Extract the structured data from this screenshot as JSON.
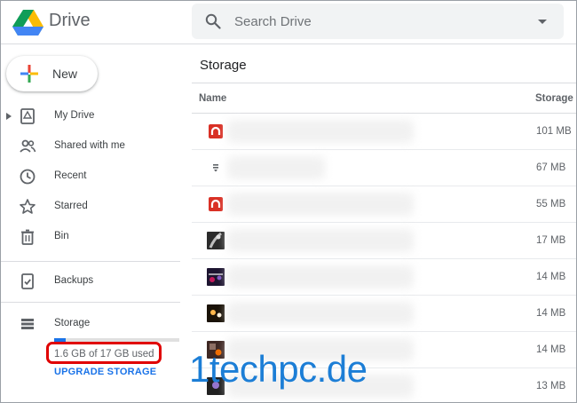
{
  "app": {
    "title": "Drive"
  },
  "search": {
    "placeholder": "Search Drive"
  },
  "sidebar": {
    "new_label": "New",
    "items": [
      {
        "label": "My Drive",
        "icon": "my-drive-icon"
      },
      {
        "label": "Shared with me",
        "icon": "shared-icon"
      },
      {
        "label": "Recent",
        "icon": "clock-icon"
      },
      {
        "label": "Starred",
        "icon": "star-icon"
      },
      {
        "label": "Bin",
        "icon": "trash-icon"
      },
      {
        "label": "Backups",
        "icon": "backup-icon"
      },
      {
        "label": "Storage",
        "icon": "storage-icon"
      }
    ],
    "quota": {
      "text": "1.6 GB of 17 GB used",
      "used_fraction": 0.094,
      "upgrade_label": "UPGRADE STORAGE"
    }
  },
  "main": {
    "title": "Storage",
    "columns": {
      "name": "Name",
      "size": "Storage used"
    },
    "rows": [
      {
        "thumb": "red-app-icon",
        "size": "101 MB"
      },
      {
        "thumb": "generic-file-icon",
        "size": "67 MB"
      },
      {
        "thumb": "red-app-icon",
        "size": "55 MB"
      },
      {
        "thumb": "photo-thumbnail",
        "size": "17 MB"
      },
      {
        "thumb": "photo-thumbnail",
        "size": "14 MB"
      },
      {
        "thumb": "photo-thumbnail",
        "size": "14 MB"
      },
      {
        "thumb": "photo-thumbnail",
        "size": "14 MB"
      },
      {
        "thumb": "photo-thumbnail",
        "size": "13 MB"
      }
    ]
  },
  "watermark": "1techpc.de",
  "colors": {
    "accent": "#1a73e8",
    "highlight": "#e00000",
    "watermark": "#1c7ed6"
  }
}
